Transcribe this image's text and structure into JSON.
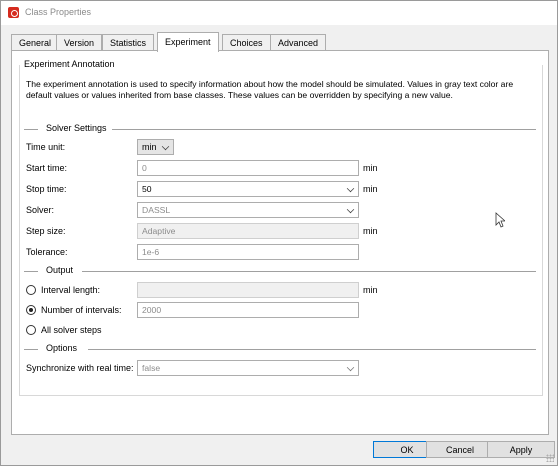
{
  "window": {
    "title": "Class Properties"
  },
  "tabs": [
    {
      "label": "General"
    },
    {
      "label": "Version"
    },
    {
      "label": "Statistics"
    },
    {
      "label": "Experiment"
    },
    {
      "label": "Choices"
    },
    {
      "label": "Advanced"
    }
  ],
  "active_tab": "Experiment",
  "experiment": {
    "group_title": "Experiment Annotation",
    "description": "The experiment annotation is used to specify information about how the model should be simulated. Values in gray text color are default values or values inherited from base classes. These values can be overridden by specifying a new value.",
    "solver_settings": {
      "title": "Solver Settings",
      "time_unit_label": "Time unit:",
      "time_unit_value": "min",
      "start_time_label": "Start time:",
      "start_time_value": "0",
      "start_time_unit": "min",
      "stop_time_label": "Stop time:",
      "stop_time_value": "50",
      "stop_time_unit": "min",
      "solver_label": "Solver:",
      "solver_value": "DASSL",
      "step_size_label": "Step size:",
      "step_size_value": "Adaptive",
      "step_size_unit": "min",
      "tolerance_label": "Tolerance:",
      "tolerance_value": "1e-6"
    },
    "output": {
      "title": "Output",
      "interval_length_label": "Interval length:",
      "interval_length_value": "",
      "interval_length_unit": "min",
      "number_of_intervals_label": "Number of intervals:",
      "number_of_intervals_value": "2000",
      "all_solver_steps_label": "All solver steps",
      "selected": "Number of intervals:"
    },
    "options": {
      "title": "Options",
      "sync_label": "Synchronize with real time:",
      "sync_value": "false"
    }
  },
  "buttons": {
    "ok": "OK",
    "cancel": "Cancel",
    "apply": "Apply"
  },
  "colors": {
    "brand_icon": "#d52b1e",
    "default_button_border": "#0078d7",
    "gray_text": "#8c8c8c"
  },
  "icons": {
    "app": "class-properties-app-icon",
    "cursor": "mouse-pointer-icon"
  }
}
